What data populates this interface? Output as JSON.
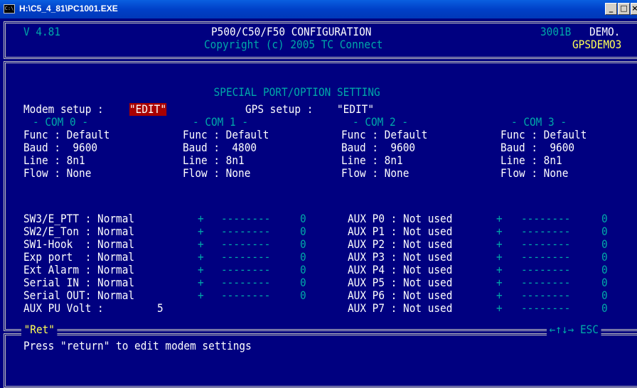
{
  "window": {
    "title": "H:\\C5_4_81\\PC1001.EXE",
    "icon_text": "C:\\",
    "min_glyph": "_",
    "max_glyph": "□",
    "close_glyph": "×"
  },
  "header": {
    "version": "V 4.81",
    "title": "P500/C50/F50 CONFIGURATION",
    "copyright": "Copyright (c) 2005 TC Connect",
    "code": "3001B",
    "mode": "DEMO.",
    "profile": "GPSDEMO3"
  },
  "section_title": "SPECIAL PORT/OPTION SETTING",
  "setup": {
    "modem_label": "Modem setup : ",
    "modem_value": "\"EDIT\"",
    "gps_label": "GPS setup : ",
    "gps_value": "\"EDIT\""
  },
  "com_ports": [
    {
      "title": "- COM 0 -",
      "func": "Func : Default",
      "baud": "Baud :  9600",
      "line": "Line : 8n1",
      "flow": "Flow : None"
    },
    {
      "title": "- COM 1 -",
      "func": "Func : Default",
      "baud": "Baud :  4800",
      "line": "Line : 8n1",
      "flow": "Flow : None"
    },
    {
      "title": "- COM 2 -",
      "func": "Func : Default",
      "baud": "Baud :  9600",
      "line": "Line : 8n1",
      "flow": "Flow : None"
    },
    {
      "title": "- COM 3 -",
      "func": "Func : Default",
      "baud": "Baud :  9600",
      "line": "Line : 8n1",
      "flow": "Flow : None"
    }
  ],
  "inputs": [
    {
      "label": "SW3/E_PTT : Normal",
      "plus": "+",
      "dashes": "--------",
      "count": "0"
    },
    {
      "label": "SW2/E_Ton : Normal",
      "plus": "+",
      "dashes": "--------",
      "count": "0"
    },
    {
      "label": "SW1-Hook  : Normal",
      "plus": "+",
      "dashes": "--------",
      "count": "0"
    },
    {
      "label": "Exp port  : Normal",
      "plus": "+",
      "dashes": "--------",
      "count": "0"
    },
    {
      "label": "Ext Alarm : Normal",
      "plus": "+",
      "dashes": "--------",
      "count": "0"
    },
    {
      "label": "Serial IN : Normal",
      "plus": "+",
      "dashes": "--------",
      "count": "0"
    },
    {
      "label": "Serial OUT: Normal",
      "plus": "+",
      "dashes": "--------",
      "count": "0"
    }
  ],
  "aux_pu": {
    "label": "AUX PU Volt :",
    "value": "5"
  },
  "aux_outputs": [
    {
      "label": "AUX P0 : Not used",
      "plus": "+",
      "dashes": "--------",
      "count": "0"
    },
    {
      "label": "AUX P1 : Not used",
      "plus": "+",
      "dashes": "--------",
      "count": "0"
    },
    {
      "label": "AUX P2 : Not used",
      "plus": "+",
      "dashes": "--------",
      "count": "0"
    },
    {
      "label": "AUX P3 : Not used",
      "plus": "+",
      "dashes": "--------",
      "count": "0"
    },
    {
      "label": "AUX P4 : Not used",
      "plus": "+",
      "dashes": "--------",
      "count": "0"
    },
    {
      "label": "AUX P5 : Not used",
      "plus": "+",
      "dashes": "--------",
      "count": "0"
    },
    {
      "label": "AUX P6 : Not used",
      "plus": "+",
      "dashes": "--------",
      "count": "0"
    },
    {
      "label": "AUX P7 : Not used",
      "plus": "+",
      "dashes": "--------",
      "count": "0"
    }
  ],
  "footer": {
    "key": "\"Ret\"",
    "nav_hint": "←↑↓→ ESC",
    "message": "Press \"return\" to edit modem settings"
  },
  "colors": {
    "background": "#000080",
    "text": "#ffffff",
    "dim": "#00a8a8",
    "highlight_bg": "#a80000",
    "accent": "#ffff55",
    "frame": "#c0c0c0"
  }
}
